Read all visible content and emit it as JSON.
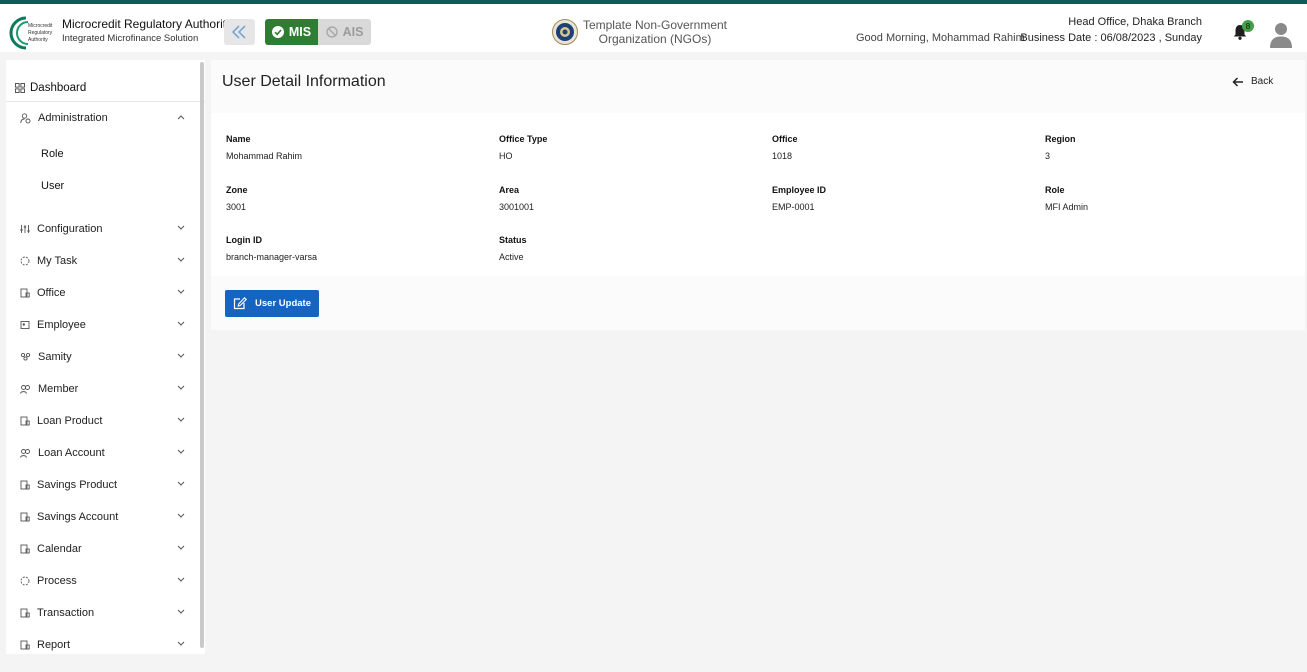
{
  "header": {
    "brand_title": "Microcredit Regulatory Authority",
    "brand_subtitle": "Integrated Microfinance Solution",
    "logo_text": [
      "Microcredit",
      "Regulatory",
      "Authority"
    ],
    "mode_mis": "MIS",
    "mode_ais": "AIS",
    "org_name": "Template Non-Government Organization (NGOs)",
    "greeting": "Good Morning, Mohammad Rahim",
    "branch": "Head Office, Dhaka Branch",
    "business_date": "Business Date : 06/08/2023 , Sunday",
    "notification_count": "8",
    "icons": [
      "double-chevron-left-icon",
      "check-circle-icon",
      "ban-icon",
      "bell-icon",
      "user-avatar-icon"
    ]
  },
  "sidebar": {
    "dashboard": "Dashboard",
    "administration": "Administration",
    "admin_children": [
      "Role",
      "User"
    ],
    "items": [
      "Configuration",
      "My Task",
      "Office",
      "Employee",
      "Samity",
      "Member",
      "Loan Product",
      "Loan Account",
      "Savings Product",
      "Savings Account",
      "Calendar",
      "Process",
      "Transaction",
      "Report"
    ]
  },
  "main": {
    "title": "User Detail Information",
    "back_label": "Back",
    "fields": [
      {
        "label": "Name",
        "value": "Mohammad Rahim"
      },
      {
        "label": "Office Type",
        "value": "HO"
      },
      {
        "label": "Office",
        "value": "1018"
      },
      {
        "label": "Region",
        "value": "3"
      },
      {
        "label": "Zone",
        "value": "3001"
      },
      {
        "label": "Area",
        "value": "3001001"
      },
      {
        "label": "Employee ID",
        "value": "EMP-0001"
      },
      {
        "label": "Role",
        "value": "MFI Admin"
      },
      {
        "label": "Login ID",
        "value": "branch-manager-varsa"
      },
      {
        "label": "Status",
        "value": "Active"
      }
    ],
    "update_button": "User Update"
  },
  "colors": {
    "stripe": "#0e5c5a",
    "mis_active": "#2e7d32",
    "primary_button": "#1565c0",
    "badge": "#43a047"
  }
}
